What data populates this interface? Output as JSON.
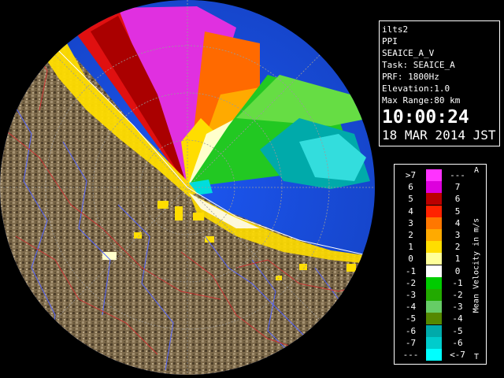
{
  "info": {
    "radar_name": "ilts2",
    "mode": "PPI",
    "product": "SEAICE_A_V",
    "task": "Task: SEAICE_A",
    "prf": "PRF: 1800Hz",
    "elevation": "Elevation:1.0",
    "max_range": "Max Range:80 km",
    "time": "10:00:24",
    "date": "18 MAR 2014 JST"
  },
  "legend": {
    "title": "Mean Velocity in m/s",
    "marker_top": "A",
    "marker_bottom": "T",
    "rows": [
      {
        "left": ">7",
        "right": "---",
        "color": "#ff33ff"
      },
      {
        "left": "6",
        "right": "7",
        "color": "#dd00dd"
      },
      {
        "left": "5",
        "right": "6",
        "color": "#bb0000"
      },
      {
        "left": "4",
        "right": "5",
        "color": "#ff2200"
      },
      {
        "left": "3",
        "right": "4",
        "color": "#ff7700"
      },
      {
        "left": "2",
        "right": "3",
        "color": "#ffaa00"
      },
      {
        "left": "1",
        "right": "2",
        "color": "#ffdd00"
      },
      {
        "left": "0",
        "right": "1",
        "color": "#ffff99"
      },
      {
        "left": "-1",
        "right": "0",
        "color": "#ffffff"
      },
      {
        "left": "-2",
        "right": "-1",
        "color": "#00cc00"
      },
      {
        "left": "-3",
        "right": "-2",
        "color": "#22aa00"
      },
      {
        "left": "-4",
        "right": "-3",
        "color": "#66cc66"
      },
      {
        "left": "-5",
        "right": "-4",
        "color": "#558800"
      },
      {
        "left": "-6",
        "right": "-5",
        "color": "#00aaaa"
      },
      {
        "left": "-7",
        "right": "-6",
        "color": "#00cccc"
      },
      {
        "left": "---",
        "right": "<-7",
        "color": "#00ffff"
      }
    ]
  },
  "colors": {
    "sea": "#1a4fe0",
    "land": "#7a6646",
    "coast_echo": "#ffdd00",
    "rivers": "#5566ff",
    "roads": "#cc3333",
    "range_rings": "#888888"
  }
}
